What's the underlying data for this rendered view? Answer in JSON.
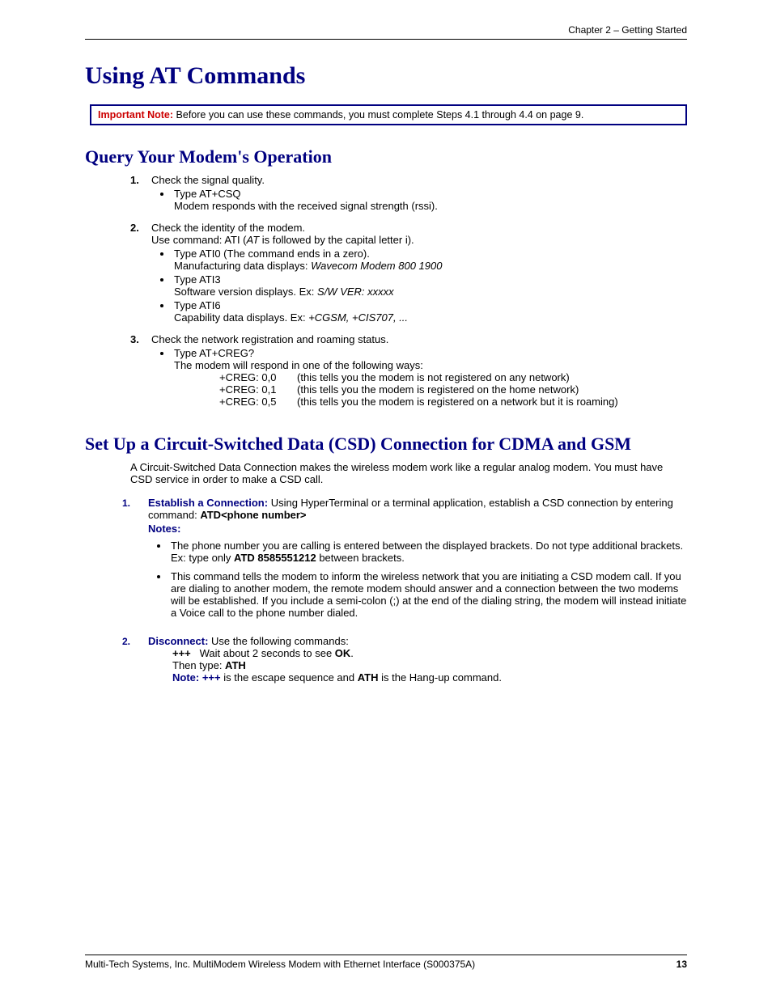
{
  "chapter_header": "Chapter 2 – Getting Started",
  "h1": "Using AT Commands",
  "note_box": {
    "label": "Important Note:",
    "text": " Before you can use these commands, you must complete Steps 4.1 through 4.4 on page 9."
  },
  "query": {
    "heading": "Query Your Modem's Operation",
    "items": [
      {
        "num": "1.",
        "lead": "Check the signal quality.",
        "bullets": [
          {
            "line1": "Type AT+CSQ",
            "line2": "Modem responds with the received signal strength (rssi)."
          }
        ]
      },
      {
        "num": "2.",
        "lead": "Check the identity of the modem.",
        "sub_pre": "Use command: ATI (",
        "sub_it": "AT",
        "sub_post": " is followed by the capital letter i).",
        "bullets": [
          {
            "line1_pre": "Type ATI0 (The command ends in a zero).",
            "line2_pre": "Manufacturing data displays: ",
            "line2_it": "Wavecom Modem 800 1900"
          },
          {
            "line1_pre": "Type ATI3",
            "line2_pre": "Software version displays. Ex: ",
            "line2_it": "S/W VER: xxxxx"
          },
          {
            "line1_pre": "Type ATI6",
            "line2_pre": "Capability data displays. Ex: ",
            "line2_it": "+CGSM, +CIS707, ..."
          }
        ]
      },
      {
        "num": "3.",
        "lead": "Check the network registration and roaming status.",
        "bullets": [
          {
            "line1": "Type AT+CREG?",
            "line2": "The modem will respond in one of the following ways:"
          }
        ],
        "creg": [
          {
            "k": "+CREG: 0,0",
            "v": "(this tells you the modem is not registered on any network)"
          },
          {
            "k": "+CREG: 0,1",
            "v": "(this tells you the modem is registered on the home network)"
          },
          {
            "k": "+CREG: 0,5",
            "v": "(this tells you the modem is registered on a network but it is roaming)"
          }
        ]
      }
    ]
  },
  "csd": {
    "heading": "Set Up a Circuit-Switched Data (CSD) Connection for CDMA and GSM",
    "intro": "A Circuit-Switched Data Connection makes the wireless modem work like a regular analog modem. You must have CSD service in order to make a CSD call.",
    "item1": {
      "num": "1.",
      "title": "Establish a Connection:",
      "body_pre": " Using HyperTerminal or a terminal application, establish a CSD connection by entering command:  ",
      "body_bold": "ATD<phone number>",
      "notes_label": "Notes:",
      "bullets": [
        {
          "pre": "The phone number you are calling is entered between the displayed brackets. Do not type additional brackets. Ex: type only ",
          "bold": "ATD 8585551212",
          "post": " between brackets."
        },
        {
          "full": "This command tells the modem to inform the wireless network that you are initiating a CSD modem call. If you are dialing to another modem, the remote modem should answer and a connection between the two modems will be established. If you include a semi-colon (;) at the end of the dialing string, the modem will instead initiate a Voice call to the phone number dialed."
        }
      ]
    },
    "item2": {
      "num": "2.",
      "title": "Disconnect:",
      "body": " Use the following commands:",
      "l1_b": "+++",
      "l1_t": "   Wait about 2 seconds to see ",
      "l1_b2": "OK",
      "l1_t2": ".",
      "l2_t": "Then type: ",
      "l2_b": "ATH",
      "l3_nb": "Note: +++",
      "l3_t1": " is the escape sequence and ",
      "l3_b": "ATH",
      "l3_t2": " is the Hang-up command."
    }
  },
  "footer": {
    "left": "Multi-Tech Systems, Inc. MultiModem Wireless Modem with Ethernet Interface (S000375A)",
    "right": "13"
  }
}
